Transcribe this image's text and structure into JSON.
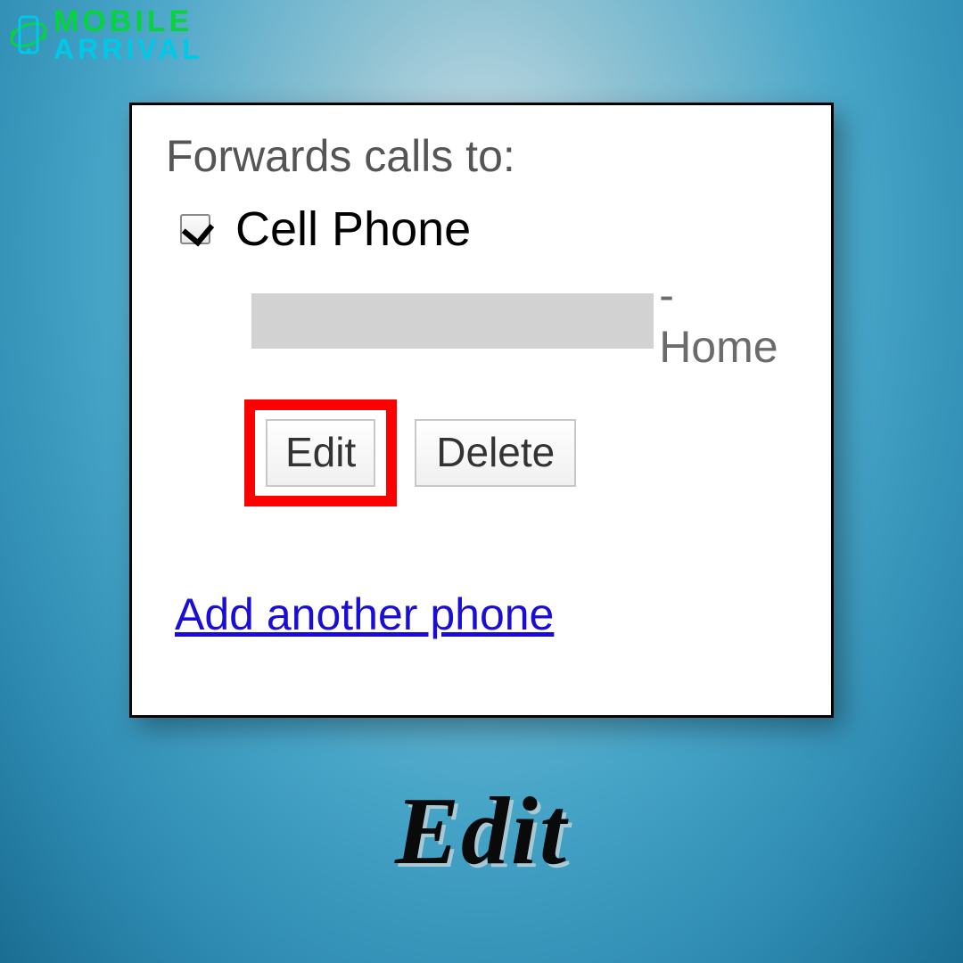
{
  "logo": {
    "line1": "MOBILE",
    "line2": "ARRIVAL"
  },
  "panel": {
    "heading": "Forwards calls to:",
    "phone_label": "Cell Phone",
    "type_label": "- Home",
    "edit_button": "Edit",
    "delete_button": "Delete",
    "add_link": "Add another phone"
  },
  "caption": "Edit"
}
